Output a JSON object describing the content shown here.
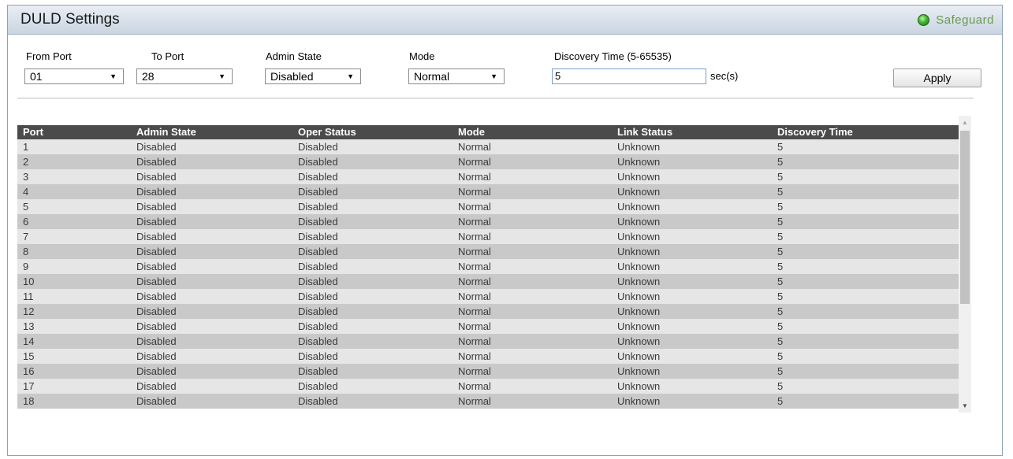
{
  "title": "DULD Settings",
  "safeguard": {
    "label": "Safeguard",
    "status_color": "#3fb52a"
  },
  "form": {
    "from_port": {
      "label": "From Port",
      "value": "01"
    },
    "to_port": {
      "label": "To Port",
      "value": "28"
    },
    "admin_state": {
      "label": "Admin State",
      "value": "Disabled"
    },
    "mode": {
      "label": "Mode",
      "value": "Normal"
    },
    "discovery_time": {
      "label": "Discovery Time (5-65535)",
      "value": "5",
      "unit": "sec(s)"
    },
    "apply_label": "Apply"
  },
  "table": {
    "columns": [
      "Port",
      "Admin State",
      "Oper Status",
      "Mode",
      "Link Status",
      "Discovery Time"
    ],
    "rows": [
      [
        "1",
        "Disabled",
        "Disabled",
        "Normal",
        "Unknown",
        "5"
      ],
      [
        "2",
        "Disabled",
        "Disabled",
        "Normal",
        "Unknown",
        "5"
      ],
      [
        "3",
        "Disabled",
        "Disabled",
        "Normal",
        "Unknown",
        "5"
      ],
      [
        "4",
        "Disabled",
        "Disabled",
        "Normal",
        "Unknown",
        "5"
      ],
      [
        "5",
        "Disabled",
        "Disabled",
        "Normal",
        "Unknown",
        "5"
      ],
      [
        "6",
        "Disabled",
        "Disabled",
        "Normal",
        "Unknown",
        "5"
      ],
      [
        "7",
        "Disabled",
        "Disabled",
        "Normal",
        "Unknown",
        "5"
      ],
      [
        "8",
        "Disabled",
        "Disabled",
        "Normal",
        "Unknown",
        "5"
      ],
      [
        "9",
        "Disabled",
        "Disabled",
        "Normal",
        "Unknown",
        "5"
      ],
      [
        "10",
        "Disabled",
        "Disabled",
        "Normal",
        "Unknown",
        "5"
      ],
      [
        "11",
        "Disabled",
        "Disabled",
        "Normal",
        "Unknown",
        "5"
      ],
      [
        "12",
        "Disabled",
        "Disabled",
        "Normal",
        "Unknown",
        "5"
      ],
      [
        "13",
        "Disabled",
        "Disabled",
        "Normal",
        "Unknown",
        "5"
      ],
      [
        "14",
        "Disabled",
        "Disabled",
        "Normal",
        "Unknown",
        "5"
      ],
      [
        "15",
        "Disabled",
        "Disabled",
        "Normal",
        "Unknown",
        "5"
      ],
      [
        "16",
        "Disabled",
        "Disabled",
        "Normal",
        "Unknown",
        "5"
      ],
      [
        "17",
        "Disabled",
        "Disabled",
        "Normal",
        "Unknown",
        "5"
      ],
      [
        "18",
        "Disabled",
        "Disabled",
        "Normal",
        "Unknown",
        "5"
      ]
    ]
  },
  "icons": {
    "dropdown": "chevron-down-icon",
    "scroll_up": "scroll-up-arrow-icon",
    "scroll_down": "scroll-down-arrow-icon",
    "status": "safeguard-status-icon"
  },
  "colors": {
    "table_header_bg": "#4b4b4b",
    "row_shade": "#c9c9c9",
    "title_bar": "#d6e0ea"
  }
}
